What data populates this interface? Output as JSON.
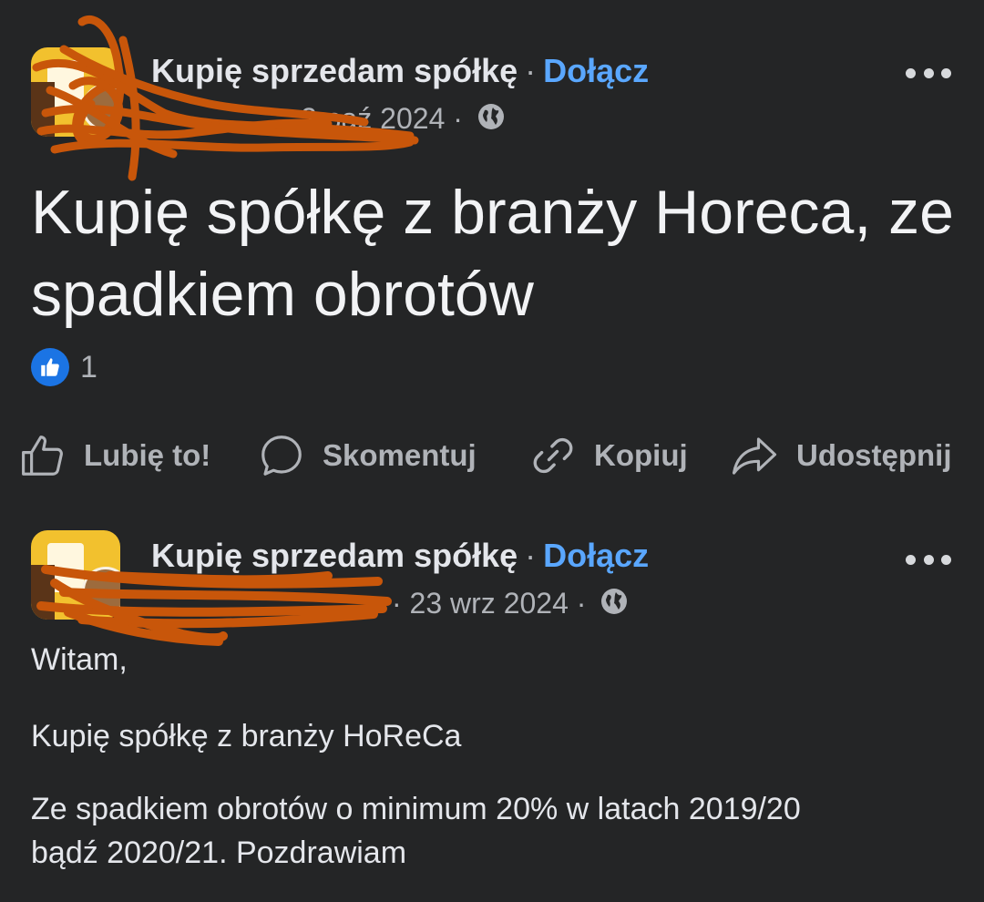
{
  "posts": [
    {
      "group_name": "Kupię sprzedam spółkę",
      "separator": "·",
      "join_label": "Dołącz",
      "author_obscured": "",
      "date": "2 paź 2024",
      "meta_separator": "·",
      "privacy_icon": "globe-icon",
      "title": "Kupię spółkę z branży Horeca, ze spadkiem obrotów",
      "reaction_icon": "thumbs-up-icon",
      "reaction_count": "1",
      "actions": [
        {
          "label": "Lubię to!",
          "icon": "thumbs-up-outline-icon"
        },
        {
          "label": "Skomentuj",
          "icon": "comment-bubble-icon"
        },
        {
          "label": "Kopiuj",
          "icon": "link-icon"
        },
        {
          "label": "Udostępnij",
          "icon": "share-arrow-icon"
        }
      ]
    },
    {
      "group_name": "Kupię sprzedam spółkę",
      "separator": "·",
      "join_label": "Dołącz",
      "author_obscured": "",
      "date": "23 wrz 2024",
      "meta_separator": "·",
      "privacy_icon": "globe-icon",
      "body": [
        "Witam,",
        "Kupię spółkę z branży HoReCa",
        "Ze spadkiem obrotów o minimum 20% w latach 2019/20 bądź 2020/21. Pozdrawiam"
      ]
    }
  ],
  "colors": {
    "background": "#242526",
    "text_primary": "#e4e6eb",
    "text_secondary": "#b0b3b8",
    "link": "#5aa7ff",
    "like_blue": "#1b74e4",
    "redaction_scribble": "#c8560a"
  }
}
